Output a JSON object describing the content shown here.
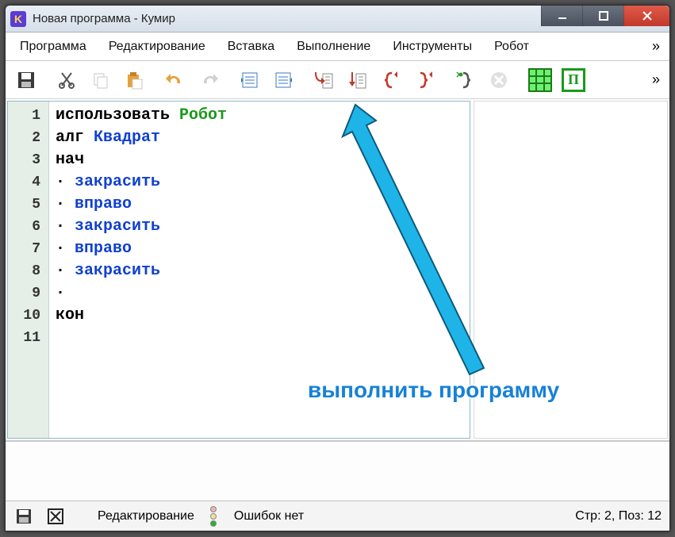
{
  "window": {
    "app_icon_letter": "K",
    "title": "Новая программа - Кумир"
  },
  "menu": {
    "items": [
      "Программа",
      "Редактирование",
      "Вставка",
      "Выполнение",
      "Инструменты",
      "Робот"
    ],
    "overflow": "»"
  },
  "toolbar": {
    "icons": [
      "save-icon",
      "cut-icon",
      "copy-icon",
      "paste-icon",
      "undo-icon",
      "redo-icon",
      "indent-left-icon",
      "indent-right-icon",
      "step-into-icon",
      "step-over-icon",
      "brace-left-icon",
      "brace-right-icon",
      "run-icon",
      "stop-icon",
      "grid-icon",
      "robot-panel-icon"
    ],
    "overflow": "»"
  },
  "code": {
    "lines": [
      {
        "n": "1",
        "tokens": [
          {
            "t": "использовать ",
            "c": "kw-black"
          },
          {
            "t": "Робот",
            "c": "kw-green"
          }
        ]
      },
      {
        "n": "2",
        "tokens": [
          {
            "t": "алг ",
            "c": "kw-black"
          },
          {
            "t": "Квадрат",
            "c": "kw-blue"
          }
        ]
      },
      {
        "n": "3",
        "tokens": [
          {
            "t": "нач",
            "c": "kw-black"
          }
        ]
      },
      {
        "n": "4",
        "tokens": [
          {
            "t": "· ",
            "c": "bullet"
          },
          {
            "t": "закрасить",
            "c": "kw-blue"
          }
        ]
      },
      {
        "n": "5",
        "tokens": [
          {
            "t": "· ",
            "c": "bullet"
          },
          {
            "t": "вправо",
            "c": "kw-blue"
          }
        ]
      },
      {
        "n": "6",
        "tokens": [
          {
            "t": "· ",
            "c": "bullet"
          },
          {
            "t": "закрасить",
            "c": "kw-blue"
          }
        ]
      },
      {
        "n": "7",
        "tokens": [
          {
            "t": "· ",
            "c": "bullet"
          },
          {
            "t": "вправо",
            "c": "kw-blue"
          }
        ]
      },
      {
        "n": "8",
        "tokens": [
          {
            "t": "· ",
            "c": "bullet"
          },
          {
            "t": "закрасить",
            "c": "kw-blue"
          }
        ]
      },
      {
        "n": "9",
        "tokens": [
          {
            "t": "·",
            "c": "bullet"
          }
        ]
      },
      {
        "n": "10",
        "tokens": [
          {
            "t": "кон",
            "c": "kw-black"
          }
        ]
      },
      {
        "n": "11",
        "tokens": []
      }
    ]
  },
  "annotation": {
    "text": "выполнить программу"
  },
  "status": {
    "mode": "Редактирование",
    "errors": "Ошибок нет",
    "position": "Стр: 2, Поз: 12"
  }
}
